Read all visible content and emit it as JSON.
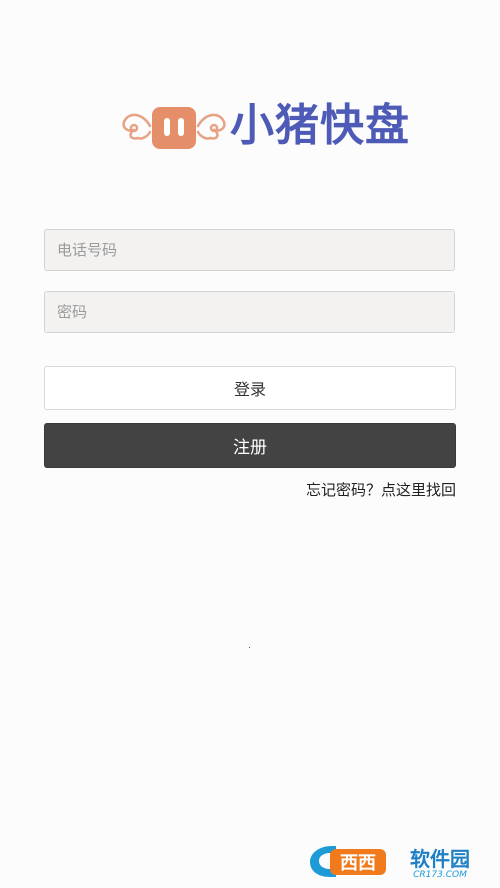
{
  "logo": {
    "app_name": "小猪快盘",
    "colors": {
      "pig": "#e58f6a",
      "wing": "#e8a283",
      "text": "#4d5bb6"
    }
  },
  "form": {
    "phone_placeholder": "电话号码",
    "password_placeholder": "密码",
    "phone_value": "",
    "password_value": ""
  },
  "buttons": {
    "login_label": "登录",
    "register_label": "注册"
  },
  "links": {
    "forgot_password": "忘记密码？点这里找回"
  },
  "watermark": {
    "text": "西西软件园",
    "domain": "CR173.COM"
  },
  "colors": {
    "background": "#fcfcfc",
    "register_button": "#434343",
    "input_background": "#f3f2f1"
  }
}
